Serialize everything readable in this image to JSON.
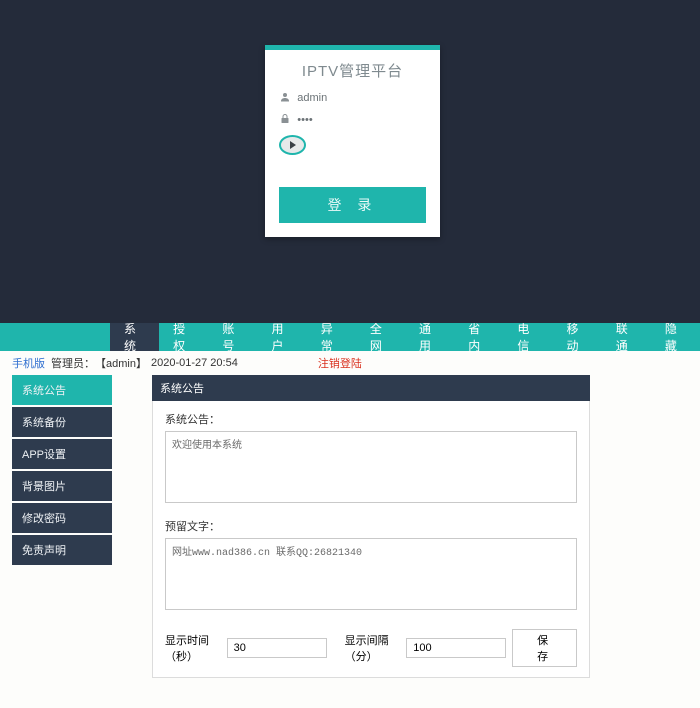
{
  "login": {
    "title": "IPTV管理平台",
    "username_value": "admin",
    "password_value": "••••",
    "captcha_value": "⟶",
    "button": "登 录"
  },
  "top_nav": [
    {
      "label": "系统",
      "active": true
    },
    {
      "label": "授权",
      "active": false
    },
    {
      "label": "账号",
      "active": false
    },
    {
      "label": "用户",
      "active": false
    },
    {
      "label": "异常",
      "active": false
    },
    {
      "label": "全网",
      "active": false
    },
    {
      "label": "通用",
      "active": false
    },
    {
      "label": "省内",
      "active": false
    },
    {
      "label": "电信",
      "active": false
    },
    {
      "label": "移动",
      "active": false
    },
    {
      "label": "联通",
      "active": false
    },
    {
      "label": "隐藏",
      "active": false
    }
  ],
  "status": {
    "mobile_link": "手机版",
    "admin_prefix": "管理员：",
    "admin_name": "【admin】",
    "datetime": "2020-01-27 20:54",
    "logout": "注销登陆"
  },
  "sidebar": [
    {
      "label": "系统公告",
      "active": true
    },
    {
      "label": "系统备份",
      "active": false
    },
    {
      "label": "APP设置",
      "active": false
    },
    {
      "label": "背景图片",
      "active": false
    },
    {
      "label": "修改密码",
      "active": false
    },
    {
      "label": "免责声明",
      "active": false
    }
  ],
  "panel": {
    "header": "系统公告",
    "field1_label": "系统公告：",
    "field1_value": "欢迎使用本系统",
    "field2_label": "预留文字：",
    "field2_value": "网址www.nad386.cn 联系QQ:26821340",
    "duration_label": "显示时间（秒）",
    "duration_value": "30",
    "interval_label": "显示间隔（分）",
    "interval_value": "100",
    "save": "保 存"
  }
}
